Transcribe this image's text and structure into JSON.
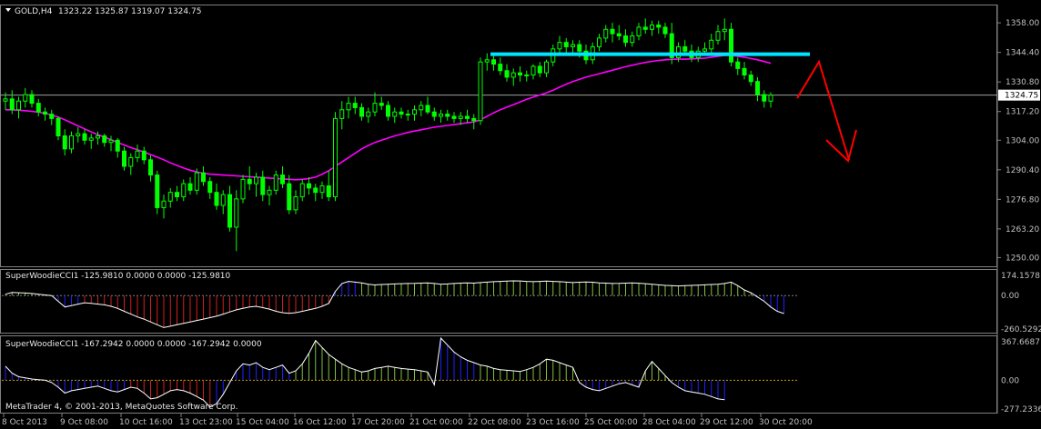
{
  "main_header": {
    "symbol_tf": "GOLD,H4",
    "ohlc": "1323.22 1325.87 1319.07 1324.75"
  },
  "copyright": "MetaTrader 4, © 2001-2013, MetaQuotes Software Corp.",
  "colors": {
    "background": "#000000",
    "bull_candle": "#00ff00",
    "bear_candle": "#00ff00",
    "doji_candle": "#00ff00",
    "ma_line": "#ff00ff",
    "resistance_line": "#00e5ff",
    "arrow": "#ff0000",
    "price_line": "#a0a0a0",
    "cci_line": "#ffffff",
    "hist_green": "#7fbf3f",
    "hist_red": "#d02020",
    "hist_blue": "#2020ff",
    "zero_line_top": "#808080",
    "zero_line_bottom": "#d0a000"
  },
  "chart_data": [
    {
      "type": "candlestick",
      "title": "GOLD,H4",
      "ohlc_text": "1323.22 1325.87 1319.07 1324.75",
      "ylim": [
        1246,
        1366
      ],
      "y_ticks": [
        "1358.00",
        "1344.40",
        "1330.80",
        "1317.20",
        "1304.00",
        "1290.40",
        "1276.80",
        "1263.20",
        "1250.00"
      ],
      "current_price": "1324.75",
      "x_ticks": [
        "8 Oct 2013",
        "9 Oct 08:00",
        "10 Oct 16:00",
        "13 Oct 23:00",
        "15 Oct 04:00",
        "16 Oct 12:00",
        "17 Oct 20:00",
        "21 Oct 00:00",
        "22 Oct 08:00",
        "23 Oct 16:00",
        "25 Oct 00:00",
        "28 Oct 04:00",
        "29 Oct 12:00",
        "30 Oct 20:00"
      ],
      "candles": [
        [
          1322,
          1326,
          1318,
          1323
        ],
        [
          1323,
          1327,
          1316,
          1318
        ],
        [
          1318,
          1324,
          1314,
          1322
        ],
        [
          1322,
          1328,
          1319,
          1325
        ],
        [
          1325,
          1327,
          1319,
          1321
        ],
        [
          1321,
          1323,
          1315,
          1317
        ],
        [
          1317,
          1319,
          1313,
          1316
        ],
        [
          1316,
          1318,
          1311,
          1314
        ],
        [
          1314,
          1315,
          1304,
          1306
        ],
        [
          1306,
          1309,
          1297,
          1300
        ],
        [
          1300,
          1308,
          1298,
          1306
        ],
        [
          1306,
          1310,
          1303,
          1307
        ],
        [
          1307,
          1309,
          1302,
          1304
        ],
        [
          1304,
          1307,
          1300,
          1305
        ],
        [
          1305,
          1308,
          1302,
          1306
        ],
        [
          1306,
          1307,
          1301,
          1303
        ],
        [
          1303,
          1306,
          1299,
          1304
        ],
        [
          1304,
          1305,
          1296,
          1299
        ],
        [
          1299,
          1301,
          1290,
          1292
        ],
        [
          1292,
          1298,
          1288,
          1296
        ],
        [
          1296,
          1302,
          1294,
          1299
        ],
        [
          1299,
          1301,
          1293,
          1295
        ],
        [
          1295,
          1297,
          1285,
          1288
        ],
        [
          1288,
          1290,
          1270,
          1273
        ],
        [
          1273,
          1279,
          1268,
          1276
        ],
        [
          1276,
          1282,
          1273,
          1280
        ],
        [
          1280,
          1283,
          1276,
          1278
        ],
        [
          1278,
          1286,
          1276,
          1284
        ],
        [
          1284,
          1287,
          1279,
          1281
        ],
        [
          1281,
          1291,
          1279,
          1289
        ],
        [
          1289,
          1292,
          1283,
          1285
        ],
        [
          1285,
          1287,
          1277,
          1280
        ],
        [
          1280,
          1284,
          1272,
          1274
        ],
        [
          1274,
          1281,
          1270,
          1279
        ],
        [
          1279,
          1283,
          1262,
          1264
        ],
        [
          1264,
          1281,
          1253,
          1277
        ],
        [
          1277,
          1288,
          1275,
          1286
        ],
        [
          1286,
          1292,
          1281,
          1284
        ],
        [
          1284,
          1289,
          1278,
          1287
        ],
        [
          1287,
          1290,
          1276,
          1279
        ],
        [
          1279,
          1283,
          1274,
          1281
        ],
        [
          1281,
          1290,
          1279,
          1288
        ],
        [
          1288,
          1292,
          1282,
          1284
        ],
        [
          1284,
          1288,
          1270,
          1272
        ],
        [
          1272,
          1281,
          1270,
          1278
        ],
        [
          1278,
          1286,
          1276,
          1284
        ],
        [
          1284,
          1287,
          1279,
          1282
        ],
        [
          1282,
          1284,
          1276,
          1280
        ],
        [
          1280,
          1285,
          1277,
          1283
        ],
        [
          1283,
          1290,
          1276,
          1278
        ],
        [
          1278,
          1317,
          1276,
          1314
        ],
        [
          1314,
          1322,
          1309,
          1318
        ],
        [
          1318,
          1324,
          1314,
          1321
        ],
        [
          1321,
          1324,
          1316,
          1319
        ],
        [
          1319,
          1321,
          1313,
          1315
        ],
        [
          1315,
          1319,
          1312,
          1317
        ],
        [
          1317,
          1326,
          1315,
          1321
        ],
        [
          1321,
          1324,
          1318,
          1320
        ],
        [
          1320,
          1322,
          1313,
          1315
        ],
        [
          1315,
          1319,
          1312,
          1317
        ],
        [
          1317,
          1319,
          1314,
          1316
        ],
        [
          1316,
          1318,
          1313,
          1316
        ],
        [
          1316,
          1320,
          1313,
          1318
        ],
        [
          1318,
          1322,
          1315,
          1320
        ],
        [
          1320,
          1324,
          1316,
          1317
        ],
        [
          1317,
          1319,
          1313,
          1315
        ],
        [
          1315,
          1318,
          1312,
          1316
        ],
        [
          1316,
          1318,
          1313,
          1315
        ],
        [
          1315,
          1317,
          1312,
          1314
        ],
        [
          1314,
          1317,
          1311,
          1315
        ],
        [
          1315,
          1318,
          1312,
          1314
        ],
        [
          1314,
          1316,
          1309,
          1313
        ],
        [
          1313,
          1342,
          1311,
          1340
        ],
        [
          1340,
          1344,
          1336,
          1341
        ],
        [
          1341,
          1343,
          1336,
          1339
        ],
        [
          1339,
          1342,
          1334,
          1336
        ],
        [
          1336,
          1339,
          1331,
          1333
        ],
        [
          1333,
          1337,
          1329,
          1335
        ],
        [
          1335,
          1338,
          1331,
          1334
        ],
        [
          1334,
          1336,
          1331,
          1334
        ],
        [
          1334,
          1339,
          1332,
          1338
        ],
        [
          1338,
          1340,
          1333,
          1335
        ],
        [
          1335,
          1341,
          1333,
          1340
        ],
        [
          1340,
          1348,
          1338,
          1346
        ],
        [
          1346,
          1352,
          1343,
          1349
        ],
        [
          1349,
          1351,
          1344,
          1347
        ],
        [
          1347,
          1350,
          1344,
          1348
        ],
        [
          1348,
          1350,
          1342,
          1345
        ],
        [
          1345,
          1348,
          1339,
          1341
        ],
        [
          1341,
          1349,
          1339,
          1347
        ],
        [
          1347,
          1353,
          1345,
          1351
        ],
        [
          1351,
          1357,
          1349,
          1355
        ],
        [
          1355,
          1358,
          1349,
          1353
        ],
        [
          1353,
          1357,
          1350,
          1352
        ],
        [
          1352,
          1355,
          1347,
          1349
        ],
        [
          1349,
          1354,
          1347,
          1352
        ],
        [
          1352,
          1358,
          1350,
          1356
        ],
        [
          1356,
          1360,
          1353,
          1355
        ],
        [
          1355,
          1359,
          1352,
          1357
        ],
        [
          1357,
          1359,
          1353,
          1356
        ],
        [
          1356,
          1358,
          1351,
          1353
        ],
        [
          1353,
          1358,
          1339,
          1342
        ],
        [
          1342,
          1349,
          1340,
          1347
        ],
        [
          1347,
          1350,
          1343,
          1345
        ],
        [
          1345,
          1348,
          1340,
          1342
        ],
        [
          1342,
          1347,
          1340,
          1345
        ],
        [
          1345,
          1349,
          1343,
          1346
        ],
        [
          1346,
          1353,
          1344,
          1350
        ],
        [
          1350,
          1357,
          1348,
          1354
        ],
        [
          1354,
          1360,
          1350,
          1355
        ],
        [
          1355,
          1358,
          1338,
          1340
        ],
        [
          1340,
          1342,
          1334,
          1337
        ],
        [
          1337,
          1340,
          1332,
          1334
        ],
        [
          1334,
          1336,
          1329,
          1331
        ],
        [
          1331,
          1333,
          1322,
          1325
        ],
        [
          1325,
          1327,
          1319,
          1322
        ],
        [
          1322,
          1326,
          1319,
          1324.75
        ]
      ],
      "ma": [
        1318,
        1318,
        1317.8,
        1317.6,
        1317.3,
        1316.9,
        1316.3,
        1315.6,
        1314.6,
        1313.4,
        1312,
        1310.6,
        1309.2,
        1307.8,
        1306.6,
        1305.4,
        1304.2,
        1303,
        1301.8,
        1300.6,
        1299.6,
        1298.6,
        1297.4,
        1296.2,
        1295,
        1293.6,
        1292.4,
        1291.2,
        1290.2,
        1289.4,
        1288.8,
        1288.4,
        1288.2,
        1288,
        1287.8,
        1287.6,
        1287.4,
        1287.2,
        1287,
        1286.8,
        1286.6,
        1286.4,
        1286.2,
        1286,
        1285.8,
        1286,
        1286.4,
        1287,
        1288.4,
        1290,
        1292,
        1294,
        1296,
        1298,
        1300,
        1301.6,
        1303,
        1304,
        1305,
        1306,
        1306.8,
        1307.6,
        1308.2,
        1308.8,
        1309.4,
        1310,
        1310.4,
        1310.8,
        1311.2,
        1311.6,
        1312,
        1312.4,
        1313.4,
        1315,
        1316.6,
        1318,
        1319.2,
        1320.4,
        1321.6,
        1322.8,
        1323.8,
        1324.8,
        1325.8,
        1327,
        1328.4,
        1329.8,
        1331,
        1332,
        1333,
        1333.8,
        1334.6,
        1335.4,
        1336.2,
        1337,
        1337.8,
        1338.5,
        1339.2,
        1339.8,
        1340.3,
        1340.7,
        1341,
        1341.2,
        1341.3,
        1341.3,
        1341.4,
        1341.6,
        1341.8,
        1342.2,
        1342.6,
        1343,
        1343,
        1342.6,
        1342.2,
        1341.6,
        1341,
        1340.2,
        1339.4
      ],
      "resistance_level": 1343.6
    },
    {
      "type": "histogram",
      "title": "SuperWoodieCCI1 -125.9810 0.0000 0.0000 -125.9810",
      "ylim": [
        -260.5292,
        174.1578
      ],
      "y_ticks": [
        "174.1578",
        "0.00",
        "-260.5292"
      ]
    },
    {
      "type": "histogram",
      "title": "SuperWoodieCCI1 -167.2942 0.0000 0.0000 -167.2942 0.0000",
      "ylim": [
        -277.2336,
        367.6687
      ],
      "y_ticks": [
        "367.6687",
        "0.00",
        "-277.2336"
      ]
    }
  ],
  "cci1": {
    "values": [
      10,
      22,
      20,
      18,
      15,
      10,
      5,
      0,
      -40,
      -80,
      -70,
      -60,
      -50,
      -55,
      -60,
      -65,
      -75,
      -90,
      -110,
      -130,
      -150,
      -165,
      -185,
      -205,
      -225,
      -215,
      -205,
      -195,
      -185,
      -175,
      -165,
      -155,
      -145,
      -130,
      -115,
      -100,
      -90,
      -80,
      -75,
      -85,
      -95,
      -110,
      -120,
      -125,
      -120,
      -110,
      -100,
      -90,
      -75,
      -55,
      30,
      85,
      100,
      95,
      90,
      80,
      75,
      78,
      80,
      82,
      84,
      85,
      86,
      88,
      90,
      85,
      80,
      82,
      85,
      88,
      90,
      88,
      92,
      95,
      98,
      100,
      102,
      104,
      103,
      100,
      98,
      100,
      102,
      100,
      98,
      95,
      92,
      94,
      96,
      94,
      90,
      88,
      85,
      86,
      88,
      90,
      87,
      84,
      80,
      76,
      72,
      70,
      68,
      70,
      72,
      74,
      76,
      78,
      80,
      85,
      95,
      70,
      40,
      20,
      -10,
      -40,
      -80,
      -110,
      -126
    ],
    "colors": "mixed"
  },
  "cci2": {
    "values": [
      120,
      60,
      30,
      20,
      10,
      5,
      0,
      -20,
      -60,
      -110,
      -90,
      -80,
      -70,
      -60,
      -50,
      -70,
      -90,
      -100,
      -80,
      -60,
      -70,
      -110,
      -160,
      -150,
      -120,
      -90,
      -80,
      -90,
      -110,
      -140,
      -170,
      -230,
      -200,
      -120,
      -20,
      80,
      140,
      130,
      150,
      110,
      90,
      110,
      130,
      60,
      80,
      140,
      230,
      340,
      280,
      220,
      180,
      140,
      110,
      90,
      70,
      80,
      100,
      110,
      120,
      110,
      100,
      95,
      90,
      80,
      70,
      -40,
      360,
      300,
      240,
      200,
      170,
      150,
      130,
      120,
      100,
      90,
      85,
      80,
      75,
      90,
      110,
      140,
      180,
      170,
      150,
      130,
      110,
      -20,
      -60,
      -80,
      -90,
      -70,
      -50,
      -30,
      -20,
      -40,
      -60,
      80,
      160,
      100,
      40,
      -20,
      -60,
      -90,
      -100,
      -110,
      -120,
      -140,
      -160,
      -167
    ]
  }
}
